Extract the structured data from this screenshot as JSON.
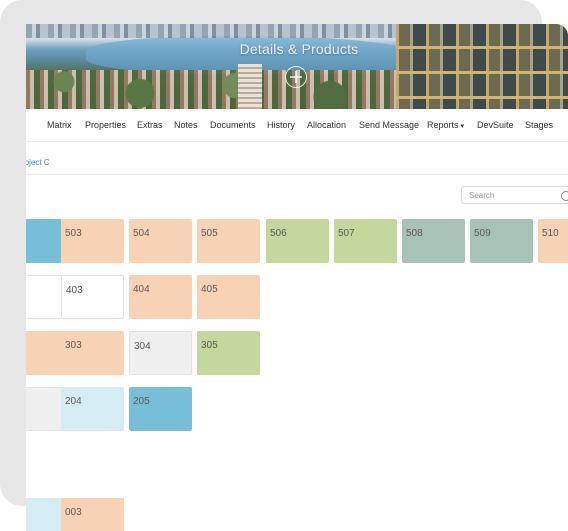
{
  "hero": {
    "title": "Details & Products",
    "add_icon": "plus-circle-icon"
  },
  "nav": {
    "items": [
      "Matrix",
      "Properties",
      "Extras",
      "Notes",
      "Documents",
      "History",
      "Allocation",
      "Send Message",
      "Reports",
      "DevSuite",
      "Stages"
    ],
    "reports_caret": "▾"
  },
  "breadcrumb": "roject C",
  "search": {
    "placeholder": "Search",
    "icon": "search-icon"
  },
  "colors": {
    "peach": "#f8d2b4",
    "green": "#c4d89e",
    "sage": "#a8c2b7",
    "blue": "#77bfd9",
    "lightblue": "#d6ecf5",
    "grey": "#efefef",
    "white": "#ffffff"
  },
  "units": {
    "row5": [
      {
        "label": "",
        "status": "blue"
      },
      {
        "label": "503",
        "status": "peach"
      },
      {
        "label": "504",
        "status": "peach"
      },
      {
        "label": "505",
        "status": "peach"
      },
      {
        "label": "506",
        "status": "green"
      },
      {
        "label": "507",
        "status": "green"
      },
      {
        "label": "508",
        "status": "sage"
      },
      {
        "label": "509",
        "status": "sage"
      },
      {
        "label": "510",
        "status": "peach"
      }
    ],
    "row4": [
      {
        "label": "",
        "status": "white"
      },
      {
        "label": "403",
        "status": "white"
      },
      {
        "label": "404",
        "status": "peach"
      },
      {
        "label": "405",
        "status": "peach"
      }
    ],
    "row3": [
      {
        "label": "",
        "status": "peach"
      },
      {
        "label": "303",
        "status": "peach"
      },
      {
        "label": "304",
        "status": "grey"
      },
      {
        "label": "305",
        "status": "green"
      }
    ],
    "row2": [
      {
        "label": "",
        "status": "grey"
      },
      {
        "label": "204",
        "status": "lightblue"
      },
      {
        "label": "205",
        "status": "blue"
      }
    ],
    "row0": [
      {
        "label": "",
        "status": "lightblue"
      },
      {
        "label": "003",
        "status": "peach"
      }
    ]
  }
}
